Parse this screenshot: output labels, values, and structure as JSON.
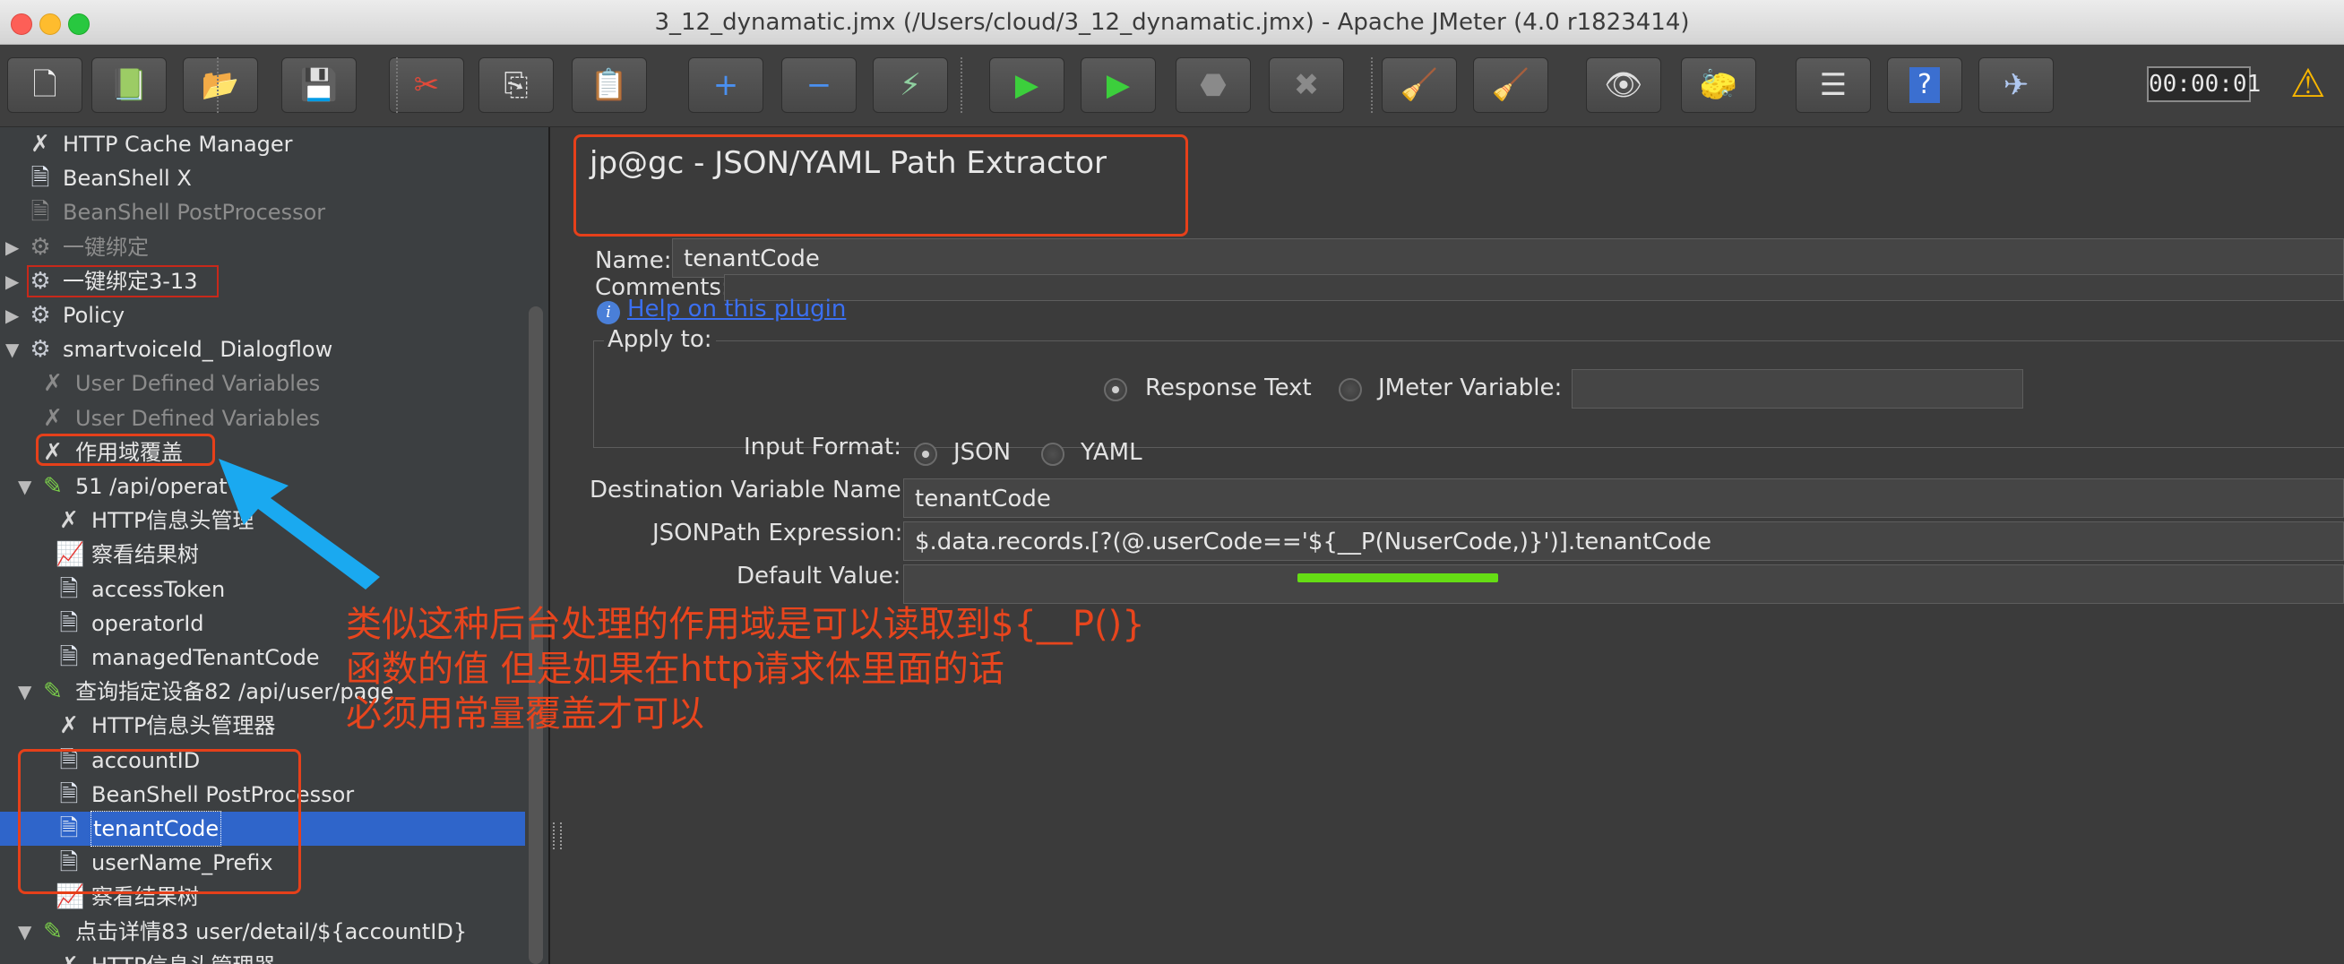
{
  "window": {
    "title": "3_12_dynamatic.jmx (/Users/cloud/3_12_dynamatic.jmx) - Apache JMeter (4.0 r1823414)"
  },
  "toolbar": {
    "timer": "00:00:01",
    "buttons": [
      {
        "name": "new-button",
        "icon": "new-file-icon",
        "glyph": "🗋"
      },
      {
        "name": "templates-button",
        "icon": "templates-icon",
        "glyph": "📗"
      },
      {
        "name": "open-button",
        "icon": "open-folder-icon",
        "glyph": "📂"
      },
      {
        "name": "save-button",
        "icon": "save-icon",
        "glyph": "💾"
      },
      {
        "name": "cut-button",
        "icon": "scissors-icon",
        "glyph": "✂"
      },
      {
        "name": "copy-button",
        "icon": "copy-icon",
        "glyph": "⎘"
      },
      {
        "name": "paste-button",
        "icon": "paste-icon",
        "glyph": "📋"
      },
      {
        "name": "expand-button",
        "icon": "plus-icon",
        "glyph": "+"
      },
      {
        "name": "collapse-button",
        "icon": "minus-icon",
        "glyph": "−"
      },
      {
        "name": "toggle-button",
        "icon": "toggle-icon",
        "glyph": "⚡"
      },
      {
        "name": "start-button",
        "icon": "play-icon",
        "glyph": "▶"
      },
      {
        "name": "start-no-pauses-button",
        "icon": "play-no-timers-icon",
        "glyph": "▶"
      },
      {
        "name": "stop-button",
        "icon": "stop-icon",
        "glyph": "⬣"
      },
      {
        "name": "shutdown-button",
        "icon": "shutdown-icon",
        "glyph": "✖"
      },
      {
        "name": "clear-button",
        "icon": "broom-clear-icon",
        "glyph": "🧹"
      },
      {
        "name": "clear-all-button",
        "icon": "broom-clear-all-icon",
        "glyph": "🧹"
      },
      {
        "name": "search-button",
        "icon": "binoculars-icon",
        "glyph": "👁"
      },
      {
        "name": "reset-search-button",
        "icon": "reset-search-icon",
        "glyph": "🧽"
      },
      {
        "name": "function-helper-button",
        "icon": "function-helper-icon",
        "glyph": "☰"
      },
      {
        "name": "help-button",
        "icon": "help-icon",
        "glyph": "?"
      },
      {
        "name": "remote-button",
        "icon": "remote-icon",
        "glyph": "✈"
      }
    ]
  },
  "tree": {
    "nodes": [
      {
        "label": "HTTP Cache Manager",
        "icon": "wrench-icon",
        "indent": 0,
        "arrow": "",
        "disabled": false
      },
      {
        "label": "BeanShell X",
        "icon": "script-icon",
        "indent": 0,
        "arrow": "",
        "disabled": false
      },
      {
        "label": "BeanShell PostProcessor",
        "icon": "script-icon",
        "indent": 0,
        "arrow": "",
        "disabled": true
      },
      {
        "label": "一键绑定",
        "icon": "gear-icon",
        "indent": 0,
        "arrow": "▶",
        "disabled": true
      },
      {
        "label": "一键绑定3-13",
        "icon": "gear-icon",
        "indent": 0,
        "arrow": "▶",
        "disabled": false
      },
      {
        "label": "Policy",
        "icon": "gear-icon",
        "indent": 0,
        "arrow": "▶",
        "disabled": false
      },
      {
        "label": "smartvoiceId_ Dialogflow",
        "icon": "gear-icon",
        "indent": 0,
        "arrow": "▼",
        "disabled": false
      },
      {
        "label": "User Defined Variables",
        "icon": "wrench-icon",
        "indent": 1,
        "arrow": "",
        "disabled": true
      },
      {
        "label": "User Defined Variables",
        "icon": "wrench-icon",
        "indent": 1,
        "arrow": "",
        "disabled": true
      },
      {
        "label": "作用域覆盖",
        "icon": "wrench-icon",
        "indent": 1,
        "arrow": "",
        "disabled": false
      },
      {
        "label": "51 /api/operat",
        "icon": "pipette-icon",
        "indent": 1,
        "arrow": "▼",
        "disabled": false
      },
      {
        "label": "HTTP信息头管理",
        "icon": "wrench-icon",
        "indent": 2,
        "arrow": "",
        "disabled": false
      },
      {
        "label": "察看结果树",
        "icon": "chart-icon",
        "indent": 2,
        "arrow": "",
        "disabled": false
      },
      {
        "label": "accessToken",
        "icon": "script-icon",
        "indent": 2,
        "arrow": "",
        "disabled": false
      },
      {
        "label": "operatorId",
        "icon": "script-icon",
        "indent": 2,
        "arrow": "",
        "disabled": false
      },
      {
        "label": "managedTenantCode",
        "icon": "script-icon",
        "indent": 2,
        "arrow": "",
        "disabled": false
      },
      {
        "label": "查询指定设备82 /api/user/page",
        "icon": "pipette-icon",
        "indent": 1,
        "arrow": "▼",
        "disabled": false
      },
      {
        "label": "HTTP信息头管理器",
        "icon": "wrench-icon",
        "indent": 2,
        "arrow": "",
        "disabled": false
      },
      {
        "label": "accountID",
        "icon": "script-icon",
        "indent": 2,
        "arrow": "",
        "disabled": false
      },
      {
        "label": "BeanShell PostProcessor",
        "icon": "script-icon",
        "indent": 2,
        "arrow": "",
        "disabled": false
      },
      {
        "label": "tenantCode",
        "icon": "script-icon",
        "indent": 2,
        "arrow": "",
        "disabled": false,
        "selected": true
      },
      {
        "label": "userName_Prefix",
        "icon": "script-icon",
        "indent": 2,
        "arrow": "",
        "disabled": false
      },
      {
        "label": "察看结果树",
        "icon": "chart-icon",
        "indent": 2,
        "arrow": "",
        "disabled": false
      },
      {
        "label": "点击详情83 user/detail/${accountID}",
        "icon": "pipette-icon",
        "indent": 1,
        "arrow": "▼",
        "disabled": false
      },
      {
        "label": "HTTP信息头管理器",
        "icon": "wrench-icon",
        "indent": 2,
        "arrow": "",
        "disabled": false
      }
    ]
  },
  "panel": {
    "title": "jp@gc - JSON/YAML Path Extractor",
    "name_label": "Name:",
    "name_value": "tenantCode",
    "comments_label": "Comments:",
    "comments_value": "",
    "help_link": "Help on this plugin",
    "apply_to_label": "Apply to:",
    "radio_response_text": "Response Text",
    "radio_jmeter_variable": "JMeter Variable:",
    "jmeter_variable_value": "",
    "input_format_label": "Input Format:",
    "radio_json": "JSON",
    "radio_yaml": "YAML",
    "dest_var_label": "Destination Variable Name:",
    "dest_var_value": "tenantCode",
    "jsonpath_label": "JSONPath Expression:",
    "jsonpath_value": "$.data.records.[?(@.userCode=='${__P(NuserCode,)}')].tenantCode",
    "default_value_label": "Default Value:",
    "default_value": ""
  },
  "annotation": {
    "lines": [
      "类似这种后台处理的作用域是可以读取到${__P()}",
      "函数的值 但是如果在http请求体里面的话",
      "必须用常量覆盖才可以"
    ],
    "color": "#e8451d",
    "arrow_color": "#1aa9f0"
  }
}
